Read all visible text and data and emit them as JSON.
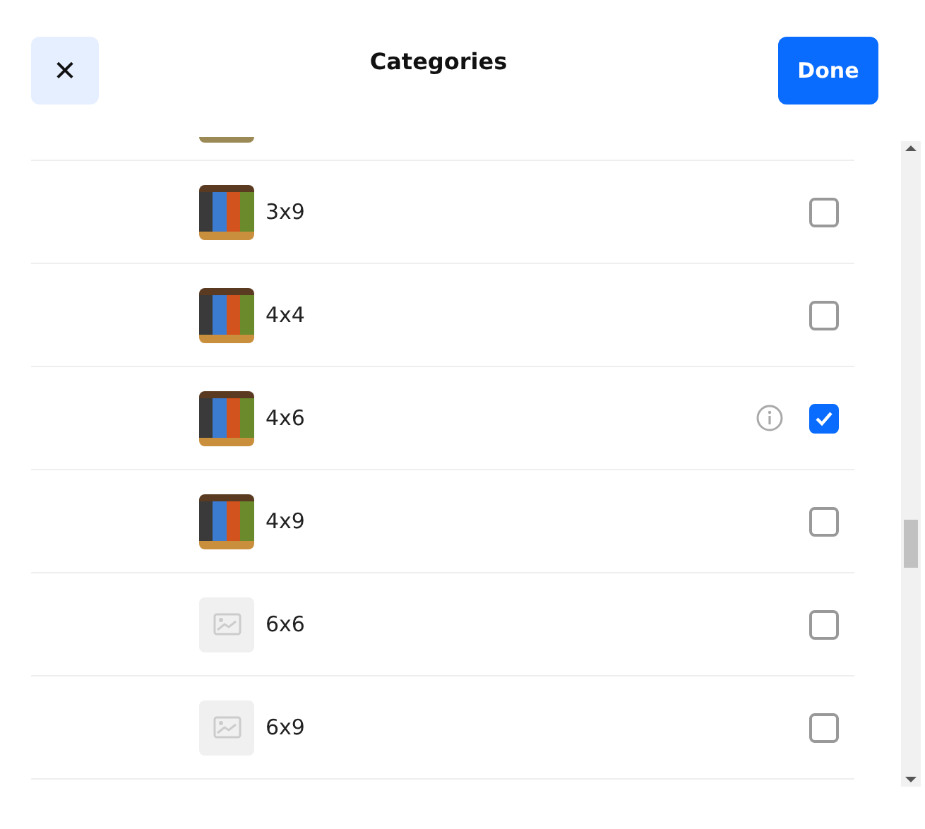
{
  "dialog": {
    "title": "Categories",
    "close_icon": "✕",
    "done_label": "Done"
  },
  "rows": [
    {
      "kind": "photo",
      "label": "3x9",
      "checked": false,
      "has_info": false
    },
    {
      "kind": "photo",
      "label": "4x4",
      "checked": false,
      "has_info": false
    },
    {
      "kind": "photo",
      "label": "4x6",
      "checked": true,
      "has_info": true
    },
    {
      "kind": "photo",
      "label": "4x9",
      "checked": false,
      "has_info": false
    },
    {
      "kind": "placeholder",
      "label": "6x6",
      "checked": false,
      "has_info": false
    },
    {
      "kind": "placeholder",
      "label": "6x9",
      "checked": false,
      "has_info": false
    }
  ]
}
